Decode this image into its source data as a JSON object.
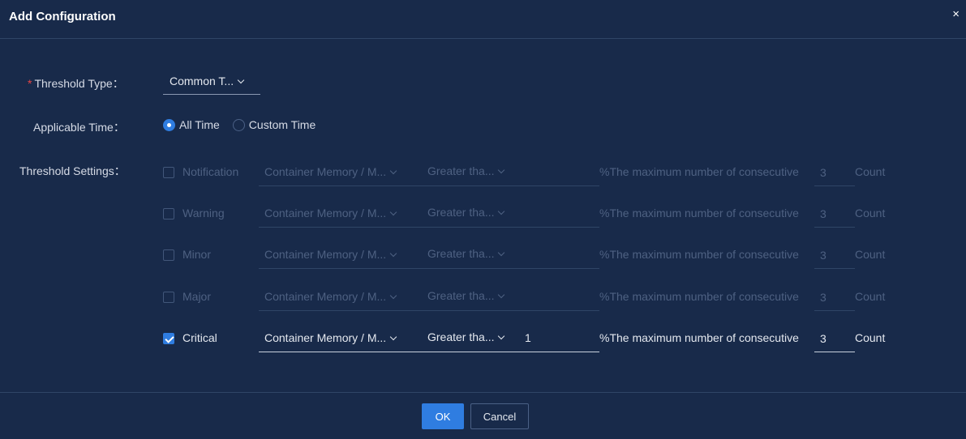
{
  "dialog": {
    "title": "Add Configuration",
    "close": "×"
  },
  "form": {
    "threshold_type_label": "Threshold Type：",
    "threshold_type_value": "Common T...",
    "applicable_time_label": "Applicable Time：",
    "applicable_time_options": [
      {
        "label": "All Time",
        "checked": true
      },
      {
        "label": "Custom Time",
        "checked": false
      }
    ],
    "threshold_settings_label": "Threshold Settings："
  },
  "rows": [
    {
      "level": "Notification",
      "checked": false,
      "metric": "Container Memory / M...",
      "operator": "Greater tha...",
      "value": "",
      "desc": "%The maximum number of consecutive",
      "count": "3",
      "unit": "Count"
    },
    {
      "level": "Warning",
      "checked": false,
      "metric": "Container Memory / M...",
      "operator": "Greater tha...",
      "value": "",
      "desc": "%The maximum number of consecutive",
      "count": "3",
      "unit": "Count"
    },
    {
      "level": "Minor",
      "checked": false,
      "metric": "Container Memory / M...",
      "operator": "Greater tha...",
      "value": "",
      "desc": "%The maximum number of consecutive",
      "count": "3",
      "unit": "Count"
    },
    {
      "level": "Major",
      "checked": false,
      "metric": "Container Memory / M...",
      "operator": "Greater tha...",
      "value": "",
      "desc": "%The maximum number of consecutive",
      "count": "3",
      "unit": "Count"
    },
    {
      "level": "Critical",
      "checked": true,
      "metric": "Container Memory / M...",
      "operator": "Greater tha...",
      "value": "1",
      "desc": "%The maximum number of consecutive",
      "count": "3",
      "unit": "Count"
    }
  ],
  "footer": {
    "ok_label": "OK",
    "cancel_label": "Cancel"
  },
  "colors": {
    "background": "#182a4a",
    "accent": "#2f7de1",
    "required": "#e54545"
  }
}
